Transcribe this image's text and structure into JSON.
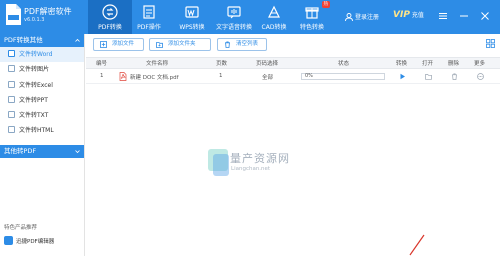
{
  "app": {
    "title": "PDF解密软件",
    "version": "v6.0.1.3"
  },
  "nav_tabs": [
    {
      "label": "PDF转换",
      "icon": "pdf-convert-icon",
      "active": true
    },
    {
      "label": "PDF操作",
      "icon": "pdf-operate-icon",
      "active": false
    },
    {
      "label": "WPS转换",
      "icon": "wps-convert-icon",
      "active": false
    },
    {
      "label": "文字语音转换",
      "icon": "text-voice-icon",
      "active": false
    },
    {
      "label": "CAD转换",
      "icon": "cad-convert-icon",
      "active": false
    },
    {
      "label": "特色转换",
      "icon": "special-convert-icon",
      "active": false,
      "badge": "热"
    }
  ],
  "header": {
    "login_label": "登录注册",
    "vip_label": "VIP",
    "vip_sub": "充值"
  },
  "sidebar": {
    "section1": "PDF转换其他",
    "items": [
      {
        "label": "文件转Word",
        "active": true
      },
      {
        "label": "文件转图片",
        "active": false
      },
      {
        "label": "文件转Excel",
        "active": false
      },
      {
        "label": "文件转PPT",
        "active": false
      },
      {
        "label": "文件转TXT",
        "active": false
      },
      {
        "label": "文件转HTML",
        "active": false
      }
    ],
    "section2": "其他转PDF",
    "promo_title": "特色产品推荐",
    "promo_item": "迅捷PDF编辑器"
  },
  "toolbar": {
    "add_file": "添加文件",
    "add_folder": "添加文件夹",
    "clear_list": "清空列表"
  },
  "table": {
    "columns": [
      "编号",
      "文件名称",
      "页数",
      "页码选择",
      "状态",
      "转换",
      "打开",
      "删除",
      "更多"
    ],
    "rows": [
      {
        "index": "1",
        "name": "新建 DOC 文档.pdf",
        "pages": "1",
        "range": "全部",
        "progress": "0%"
      }
    ]
  },
  "watermark": {
    "title": "量产资源网",
    "url": "Liangchan.net"
  },
  "colors": {
    "brand": "#2d8ce6",
    "brand_dark": "#1b6fc4",
    "badge": "#f04134"
  }
}
